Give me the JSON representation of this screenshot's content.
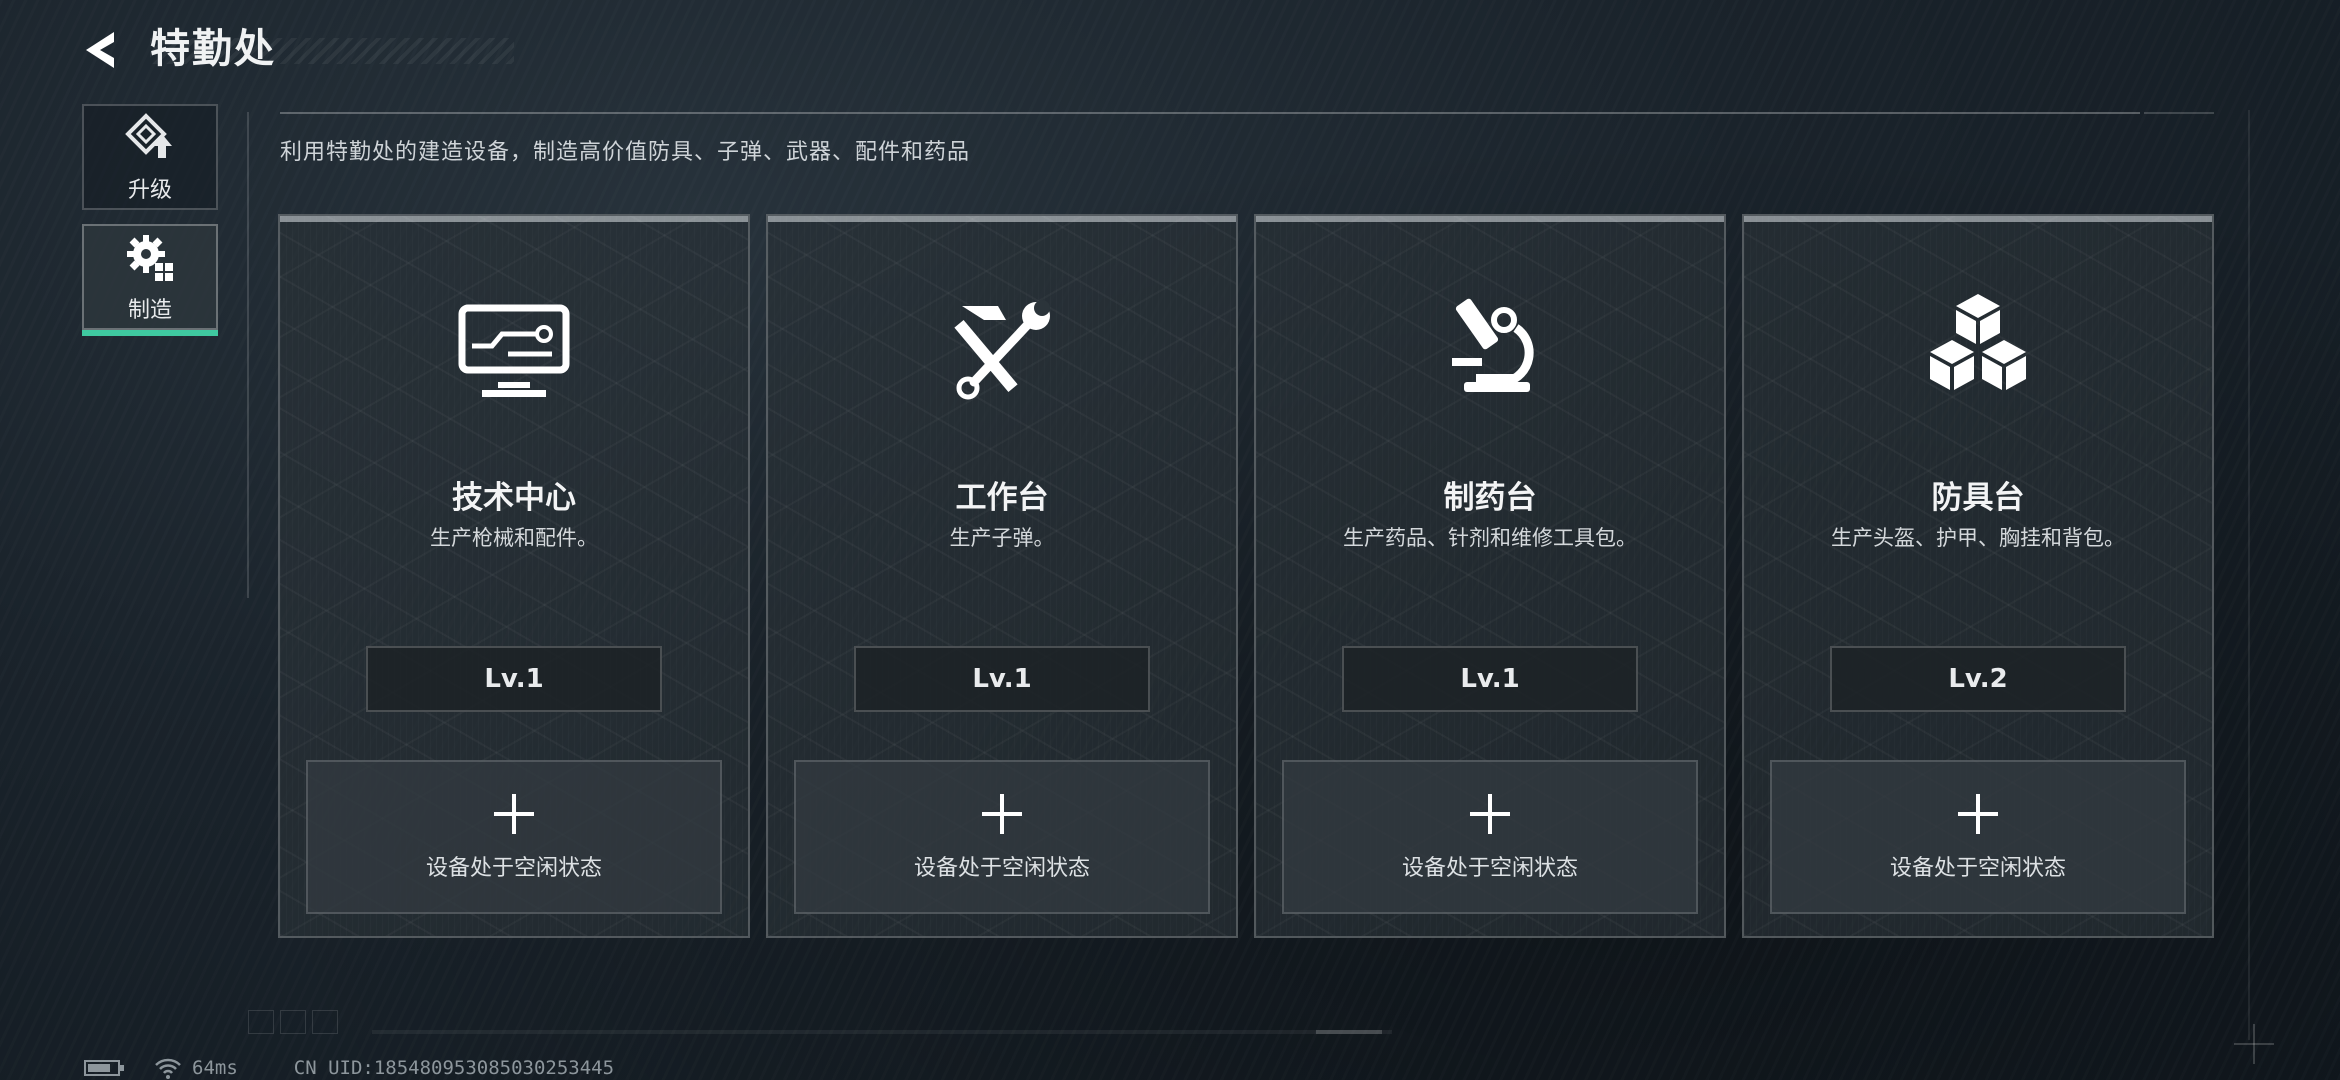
{
  "header": {
    "title": "特勤处",
    "back_icon": "back-arrow-icon"
  },
  "sidebar": {
    "items": [
      {
        "label": "升级",
        "icon": "upgrade-icon",
        "active": false
      },
      {
        "label": "制造",
        "icon": "gear-grid-icon",
        "active": true
      }
    ]
  },
  "main": {
    "subtitle": "利用特勤处的建造设备，制造高价值防具、子弹、武器、配件和药品",
    "cards": [
      {
        "name": "技术中心",
        "desc": "生产枪械和配件。",
        "level": "Lv.1",
        "icon": "monitor-icon",
        "slot_label": "设备处于空闲状态"
      },
      {
        "name": "工作台",
        "desc": "生产子弹。",
        "level": "Lv.1",
        "icon": "hammer-wrench-icon",
        "slot_label": "设备处于空闲状态"
      },
      {
        "name": "制药台",
        "desc": "生产药品、针剂和维修工具包。",
        "level": "Lv.1",
        "icon": "microscope-icon",
        "slot_label": "设备处于空闲状态"
      },
      {
        "name": "防具台",
        "desc": "生产头盔、护甲、胸挂和背包。",
        "level": "Lv.2",
        "icon": "cubes-icon",
        "slot_label": "设备处于空闲状态"
      }
    ]
  },
  "status": {
    "ping": "64ms",
    "uid": "CN UID:18548095308503025344​5"
  },
  "colors": {
    "accent": "#3fc9a0"
  }
}
